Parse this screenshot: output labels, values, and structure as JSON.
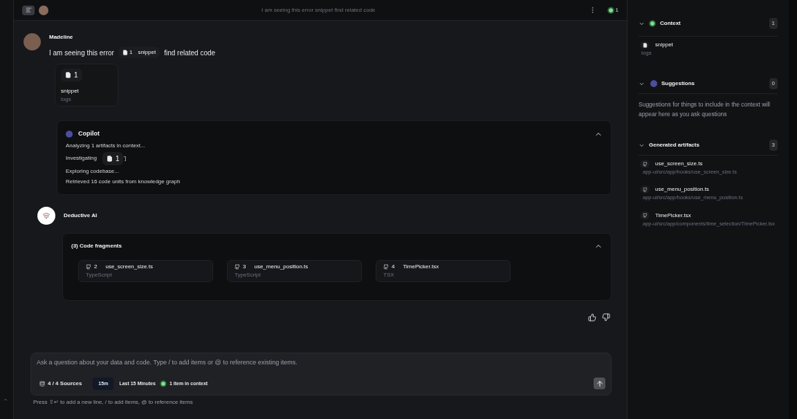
{
  "header": {
    "title": "I am seeing this error snippet find related code",
    "context_count": "1"
  },
  "user_message": {
    "author": "Madeline",
    "text_before": "I am seeing this error",
    "chip_number": "1",
    "chip_label": "snippet",
    "text_after": "find related code",
    "attachment": {
      "number": "1",
      "name": "snippet",
      "type": "logs"
    }
  },
  "copilot": {
    "title": "Copilot",
    "expanded": true,
    "lines": [
      {
        "kind": "text",
        "text": "Analyzing 1 artifacts in context..."
      },
      {
        "kind": "chip",
        "text": "Investigating",
        "chip_number": "1",
        "suffix": "']"
      },
      {
        "kind": "text",
        "text": "Exploring codebase..."
      },
      {
        "kind": "text",
        "text": "Retrieved 16 code units from knowledge graph"
      }
    ]
  },
  "assistant": {
    "author": "Deductive AI",
    "fragments_title": "(3) Code fragments",
    "expanded": true,
    "fragments": [
      {
        "number": "2",
        "name": "use_screen_size.ts",
        "language": "TypeScript"
      },
      {
        "number": "3",
        "name": "use_menu_position.ts",
        "language": "TypeScript"
      },
      {
        "number": "4",
        "name": "TimePicker.tsx",
        "language": "TSX"
      }
    ]
  },
  "composer": {
    "placeholder": "Ask a question about your data and code. Type / to add items or @ to reference existing items.",
    "sources": "4 / 4 Sources",
    "time_short": "15m",
    "time_label": "Last 15 Minutes",
    "context_label": "1 item in context",
    "hint": "Press ⇧↵ to add a new line, / to add items, @ to reference items"
  },
  "sidebar": {
    "sections": [
      {
        "kind": "context",
        "title": "Context",
        "count": "1",
        "expanded": true,
        "items": [
          {
            "name": "snippet",
            "detail": "logs"
          }
        ]
      },
      {
        "kind": "suggestions",
        "title": "Suggestions",
        "count": "0",
        "expanded": true,
        "message": "Suggestions for things to include in the context will appear here as you ask questions"
      },
      {
        "kind": "artifacts",
        "title": "Generated artifacts",
        "count": "3",
        "expanded": true,
        "items": [
          {
            "name": "use_screen_size.ts",
            "detail": "app-ui/src/app/hooks/use_screen_size.ts"
          },
          {
            "name": "use_menu_position.ts",
            "detail": "app-ui/src/app/hooks/use_menu_position.ts"
          },
          {
            "name": "TimePicker.tsx",
            "detail": "app-ui/src/app/components/time_selection/TimePicker.tsx"
          }
        ]
      }
    ]
  }
}
